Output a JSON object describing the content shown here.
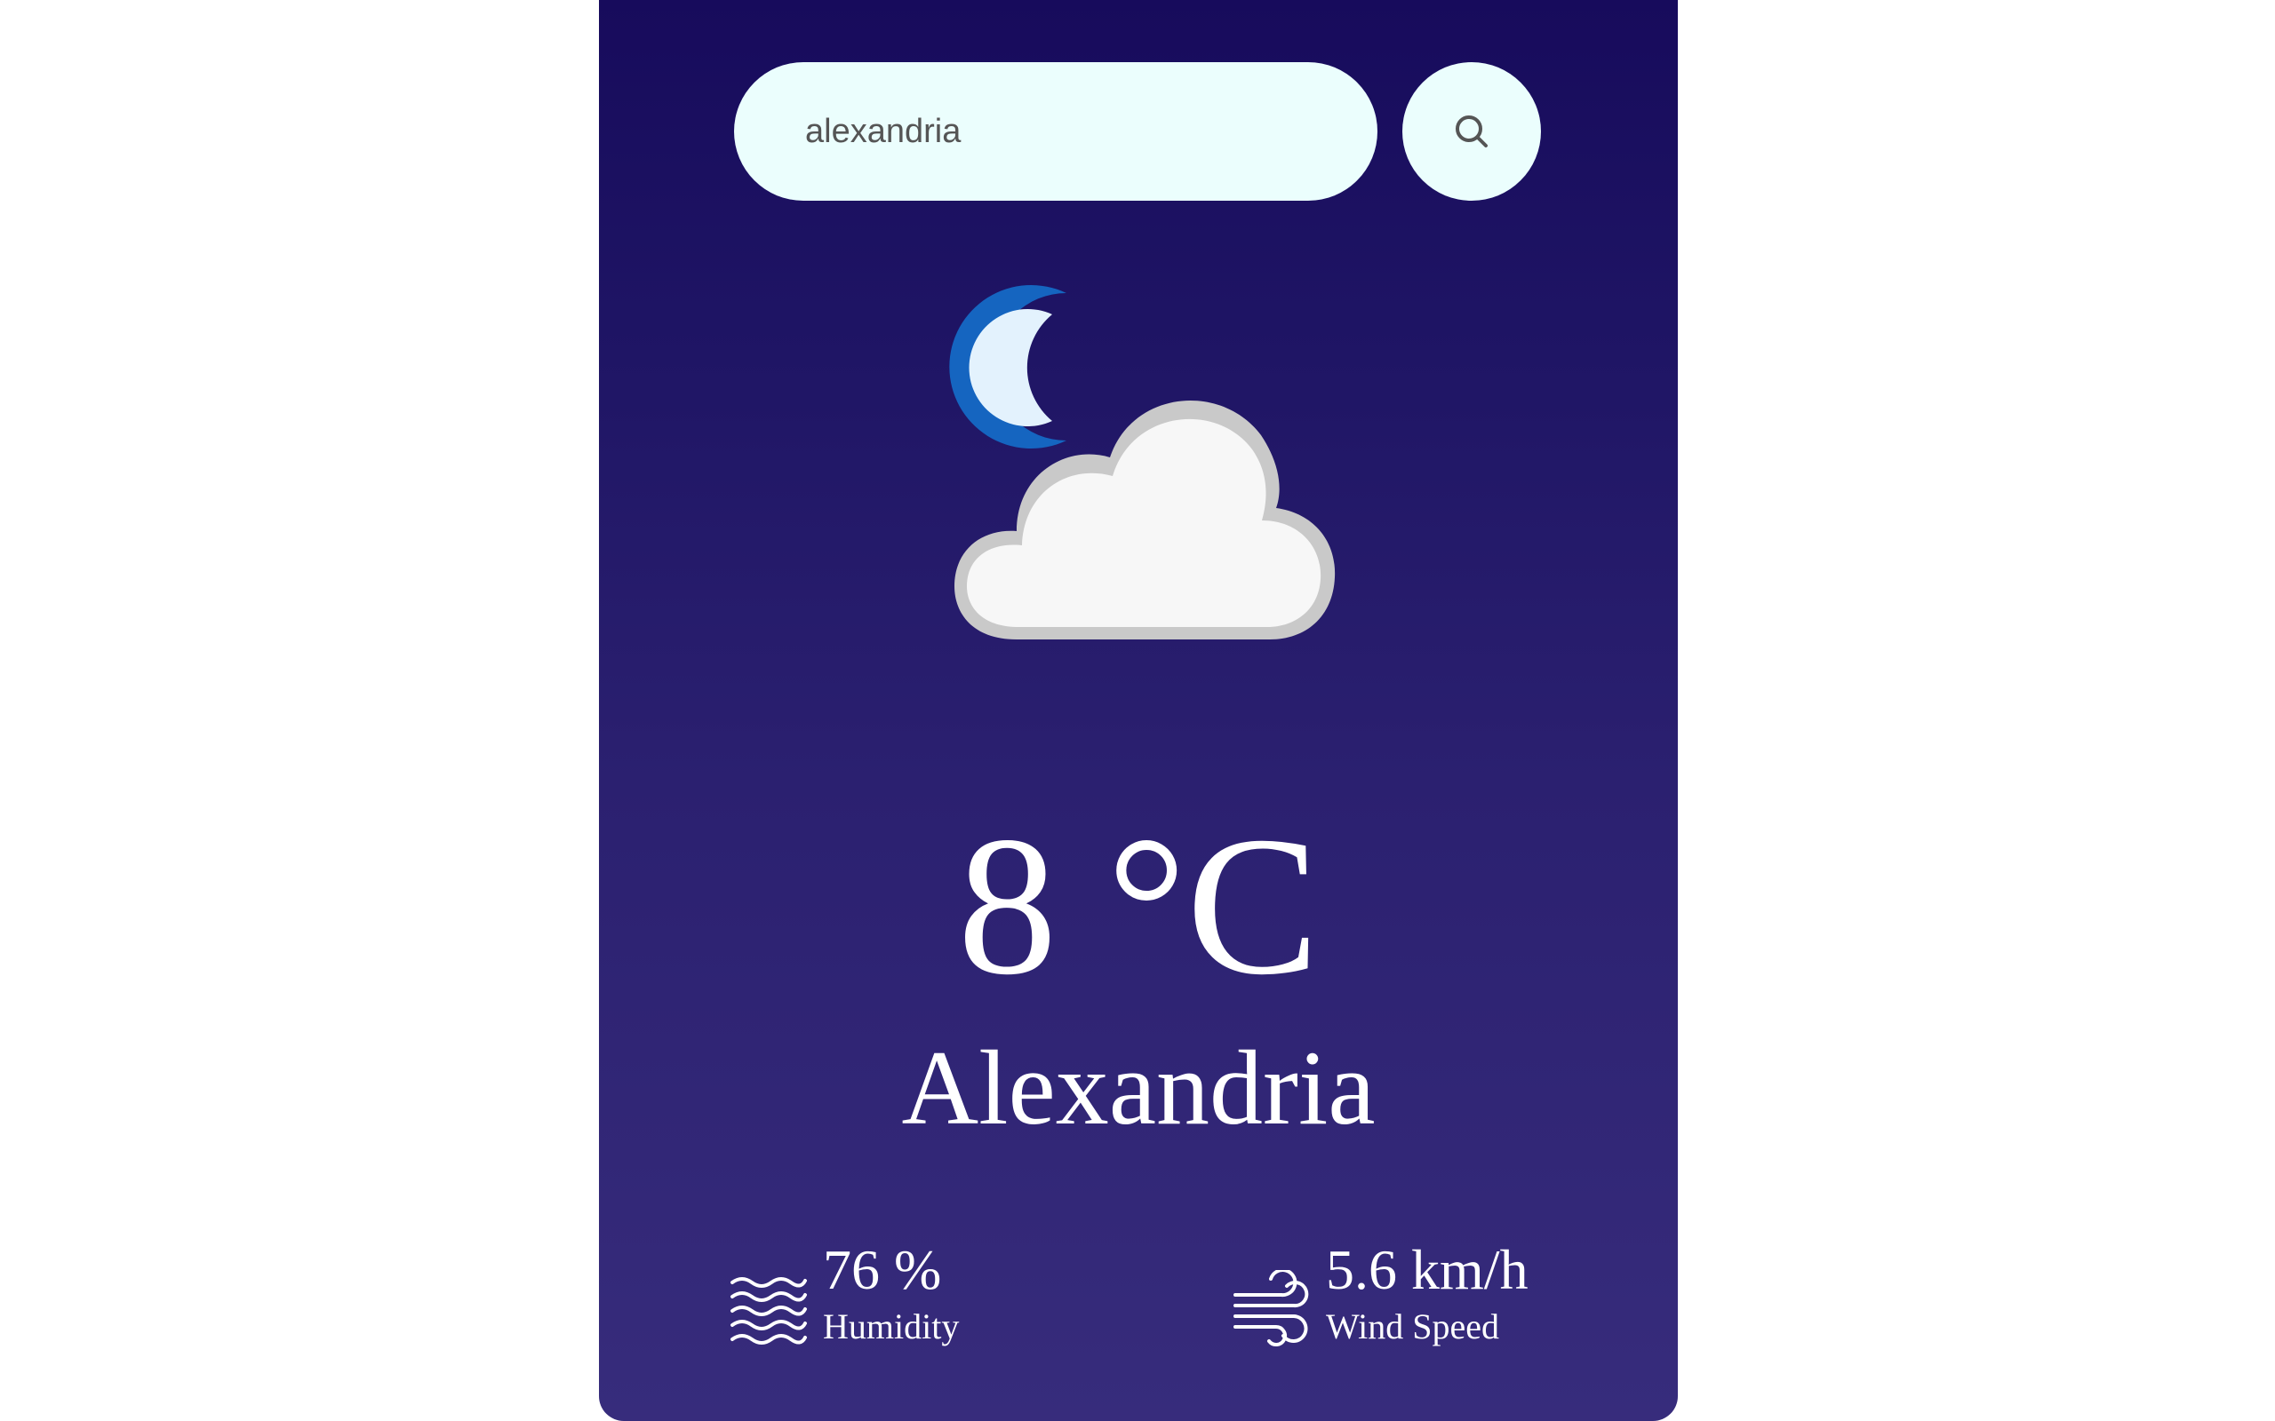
{
  "search": {
    "value": "alexandria",
    "placeholder": ""
  },
  "icons": {
    "search": "search-icon",
    "weather": "moon-cloud-icon",
    "humidity": "humidity-waves-icon",
    "wind": "wind-icon"
  },
  "weather": {
    "temperature": "8 °C",
    "city": "Alexandria"
  },
  "details": {
    "humidity": {
      "value": "76 %",
      "label": "Humidity"
    },
    "wind": {
      "value": "5.6 km/h",
      "label": "Wind Speed"
    }
  },
  "colors": {
    "card_top": "#170b5c",
    "card_bottom": "#372c7c",
    "input_bg": "#ebfefd",
    "text": "#ffffff",
    "moon": "#1565c0"
  }
}
